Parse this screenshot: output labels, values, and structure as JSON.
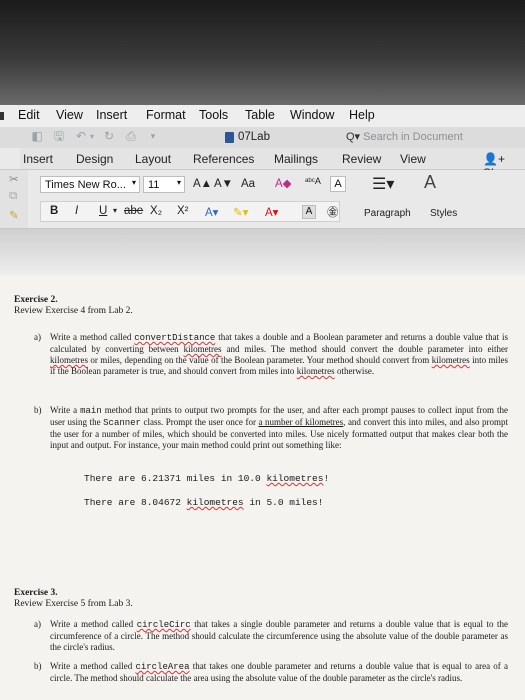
{
  "menu": [
    "Edit",
    "View",
    "Insert",
    "Format",
    "Tools",
    "Table",
    "Window",
    "Help"
  ],
  "toolbar": {
    "doc_title": "07Lab",
    "search_placeholder": "Search in Document"
  },
  "tabs": [
    "Insert",
    "Design",
    "Layout",
    "References",
    "Mailings",
    "Review",
    "View"
  ],
  "share_label": "Shar",
  "ribbon": {
    "font_name": "Times New Ro...",
    "font_size": "11",
    "bold": "B",
    "italic": "I",
    "underline": "U",
    "strike": "abe",
    "subscript": "X₂",
    "superscript": "X²",
    "grow": "A▲",
    "shrink": "A▼",
    "change_case": "Aa",
    "paragraph": "Paragraph",
    "styles": "Styles"
  },
  "document": {
    "ex2_title": "Exercise 2.",
    "ex2_sub": "Review Exercise 4 from Lab 2.",
    "ex2_a_label": "a)",
    "ex2_a_text_1": "Write a method called ",
    "ex2_a_code": "convertDistance",
    "ex2_a_text_2": " that takes a double and a Boolean parameter and returns a double value that is calculated by converting between ",
    "ex2_a_km1": "kilometres",
    "ex2_a_text_3": " and miles. The method should convert the double parameter into either ",
    "ex2_a_km2": "kilometres",
    "ex2_a_text_4": " or miles, depending on the value of the Boolean parameter. Your method should convert from ",
    "ex2_a_km3": "kilometres",
    "ex2_a_text_5": " into miles if the Boolean parameter is true, and should convert from miles into ",
    "ex2_a_km4": "kilometres",
    "ex2_a_text_6": " otherwise.",
    "ex2_b_label": "b)",
    "ex2_b_text_1": "Write a ",
    "ex2_b_code1": "main",
    "ex2_b_text_2": " method that prints to output two prompts for the user, and after each prompt pauses to collect input from the user using the ",
    "ex2_b_code2": "Scanner",
    "ex2_b_text_3": " class. Prompt the user once for ",
    "ex2_b_ul": "a number of kilometres",
    "ex2_b_text_4": ", and convert this into miles, and also prompt the user for a number of miles, which should be converted into miles. Use nicely formatted output that makes clear both the input and output. For instance, your main method could print out something like:",
    "ex2_out1_a": "There are 6.21371 miles in 10.0 ",
    "ex2_out1_b": "kilometres",
    "ex2_out1_c": "!",
    "ex2_out2_a": "There are 8.04672 ",
    "ex2_out2_b": "kilometres",
    "ex2_out2_c": " in 5.0 miles!",
    "ex3_title": "Exercise 3.",
    "ex3_sub": "Review Exercise 5 from Lab 3.",
    "ex3_a_label": "a)",
    "ex3_a_text_1": "Write a method called ",
    "ex3_a_code": "circleCirc",
    "ex3_a_text_2": " that takes a single double parameter and returns a double value that is equal to the circumference of a circle. The method should calculate the circumference using the absolute value of the double parameter as the circle's radius.",
    "ex3_b_label": "b)",
    "ex3_b_text_1": "Write a method called ",
    "ex3_b_code": "circleArea",
    "ex3_b_text_2": " that takes one double parameter and returns a double value that is equal to area of a circle. The method should calculate the area using the absolute value of the double parameter as the circle's radius."
  }
}
